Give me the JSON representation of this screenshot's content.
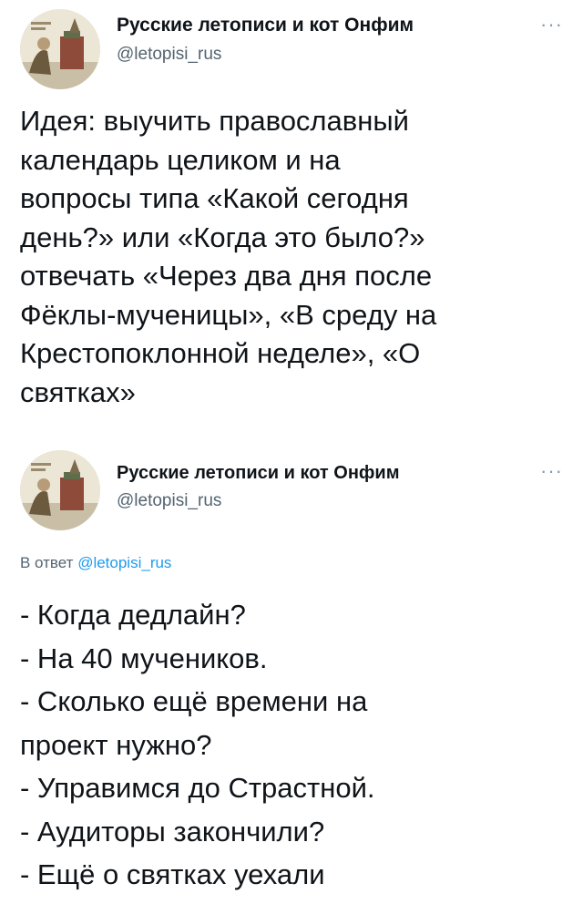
{
  "tweets": [
    {
      "author_name": "Русские летописи и кот Онфим",
      "author_handle": "@letopisi_rus",
      "more_label": "···",
      "text_lines": [
        "Идея: выучить православный",
        "календарь целиком и на",
        "вопросы типа «Какой сегодня",
        "день?» или «Когда это было?»",
        "отвечать «Через два дня после",
        "Фёклы-мученицы», «В среду на",
        "Крестопоклонной неделе», «О",
        "святках»"
      ]
    },
    {
      "author_name": "Русские летописи и кот Онфим",
      "author_handle": "@letopisi_rus",
      "more_label": "···",
      "reply_prefix": "В ответ",
      "reply_mention": "@letopisi_rus",
      "text_lines": [
        "- Когда дедлайн?",
        "- На 40 мучеников.",
        "- Сколько ещё времени на",
        "проект нужно?",
        "- Управимся до Страстной.",
        "- Аудиторы закончили?",
        "- Ещё о святках уехали"
      ]
    }
  ],
  "icons": {
    "avatar": "medieval-manuscript-illustration-avatar",
    "more": "more-options-icon"
  }
}
